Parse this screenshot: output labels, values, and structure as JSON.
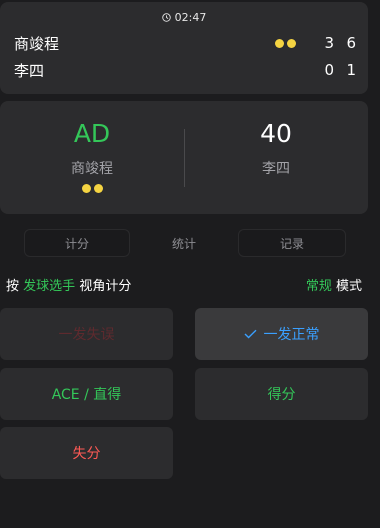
{
  "scoreboard": {
    "time": "02:47",
    "players": [
      {
        "name": "商竣程",
        "serve_dots": 2,
        "games": "3",
        "sets": "6"
      },
      {
        "name": "李四",
        "serve_dots": 0,
        "games": "0",
        "sets": "1"
      }
    ]
  },
  "point_card": {
    "left": {
      "score": "AD",
      "name": "商竣程",
      "serve_dots": 2
    },
    "right": {
      "score": "40",
      "name": "李四"
    }
  },
  "tabs": [
    {
      "label": "计分"
    },
    {
      "label": "统计"
    },
    {
      "label": "记录"
    }
  ],
  "mode_line": {
    "prefix": "按",
    "highlight": "发球选手",
    "suffix": "视角计分",
    "mode_highlight": "常规",
    "mode_suffix": "模式"
  },
  "buttons": {
    "first_fault": "一发失误",
    "first_serve_in": "一发正常",
    "ace": "ACE / 直得",
    "win_point": "得分",
    "lose_point": "失分"
  },
  "colors": {
    "background": "#1c1c1e",
    "card": "#2c2c2e",
    "green": "#34c759",
    "blue": "#3aa0ff",
    "red": "#ff5a55",
    "serve_dot": "#f5d442"
  },
  "icons": {
    "clock": "clock-icon",
    "check": "check-icon",
    "serve": "serve-dot-icon"
  }
}
